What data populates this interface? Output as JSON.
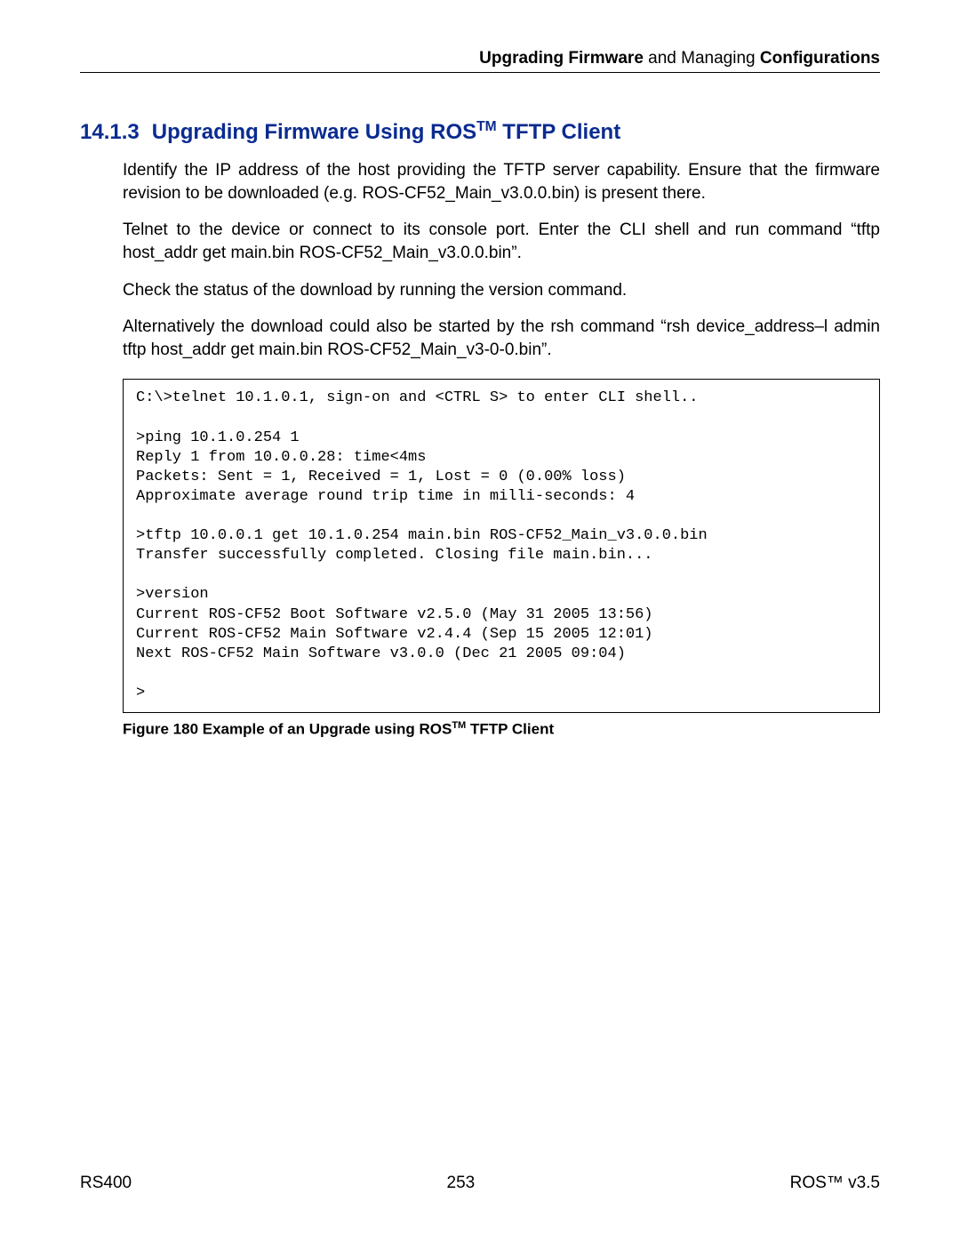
{
  "header": {
    "part1_bold": "Upgrading Firmware",
    "part2_normal": " and Managing ",
    "part3_bold": "Configurations"
  },
  "heading": {
    "number": "14.1.3",
    "title_before_tm": "Upgrading Firmware Using ROS",
    "tm": "TM",
    "title_after_tm": " TFTP Client"
  },
  "paragraphs": {
    "p1": "Identify the IP address of the host providing the TFTP server capability. Ensure that the firmware revision to be downloaded (e.g. ROS-CF52_Main_v3.0.0.bin) is present there.",
    "p2": "Telnet to the device or connect to its console port. Enter the CLI shell and run command “tftp host_addr get main.bin ROS-CF52_Main_v3.0.0.bin”.",
    "p3": "Check the status of the download by running the version command.",
    "p4": "Alternatively the download could also be started by the rsh command “rsh device_address–l admin tftp host_addr get main.bin ROS-CF52_Main_v3-0-0.bin”."
  },
  "code": "C:\\>telnet 10.1.0.1, sign-on and <CTRL S> to enter CLI shell..\n\n>ping 10.1.0.254 1\nReply 1 from 10.0.0.28: time<4ms\nPackets: Sent = 1, Received = 1, Lost = 0 (0.00% loss)\nApproximate average round trip time in milli-seconds: 4\n\n>tftp 10.0.0.1 get 10.1.0.254 main.bin ROS-CF52_Main_v3.0.0.bin\nTransfer successfully completed. Closing file main.bin...\n\n>version\nCurrent ROS-CF52 Boot Software v2.5.0 (May 31 2005 13:56)\nCurrent ROS-CF52 Main Software v2.4.4 (Sep 15 2005 12:01)\nNext ROS-CF52 Main Software v3.0.0 (Dec 21 2005 09:04)\n\n>",
  "figure_caption": {
    "before_tm": "Figure 180 Example of an Upgrade using ROS",
    "tm": "TM",
    "after_tm": " TFTP Client"
  },
  "footer": {
    "left": "RS400",
    "center": "253",
    "right": "ROS™  v3.5"
  }
}
